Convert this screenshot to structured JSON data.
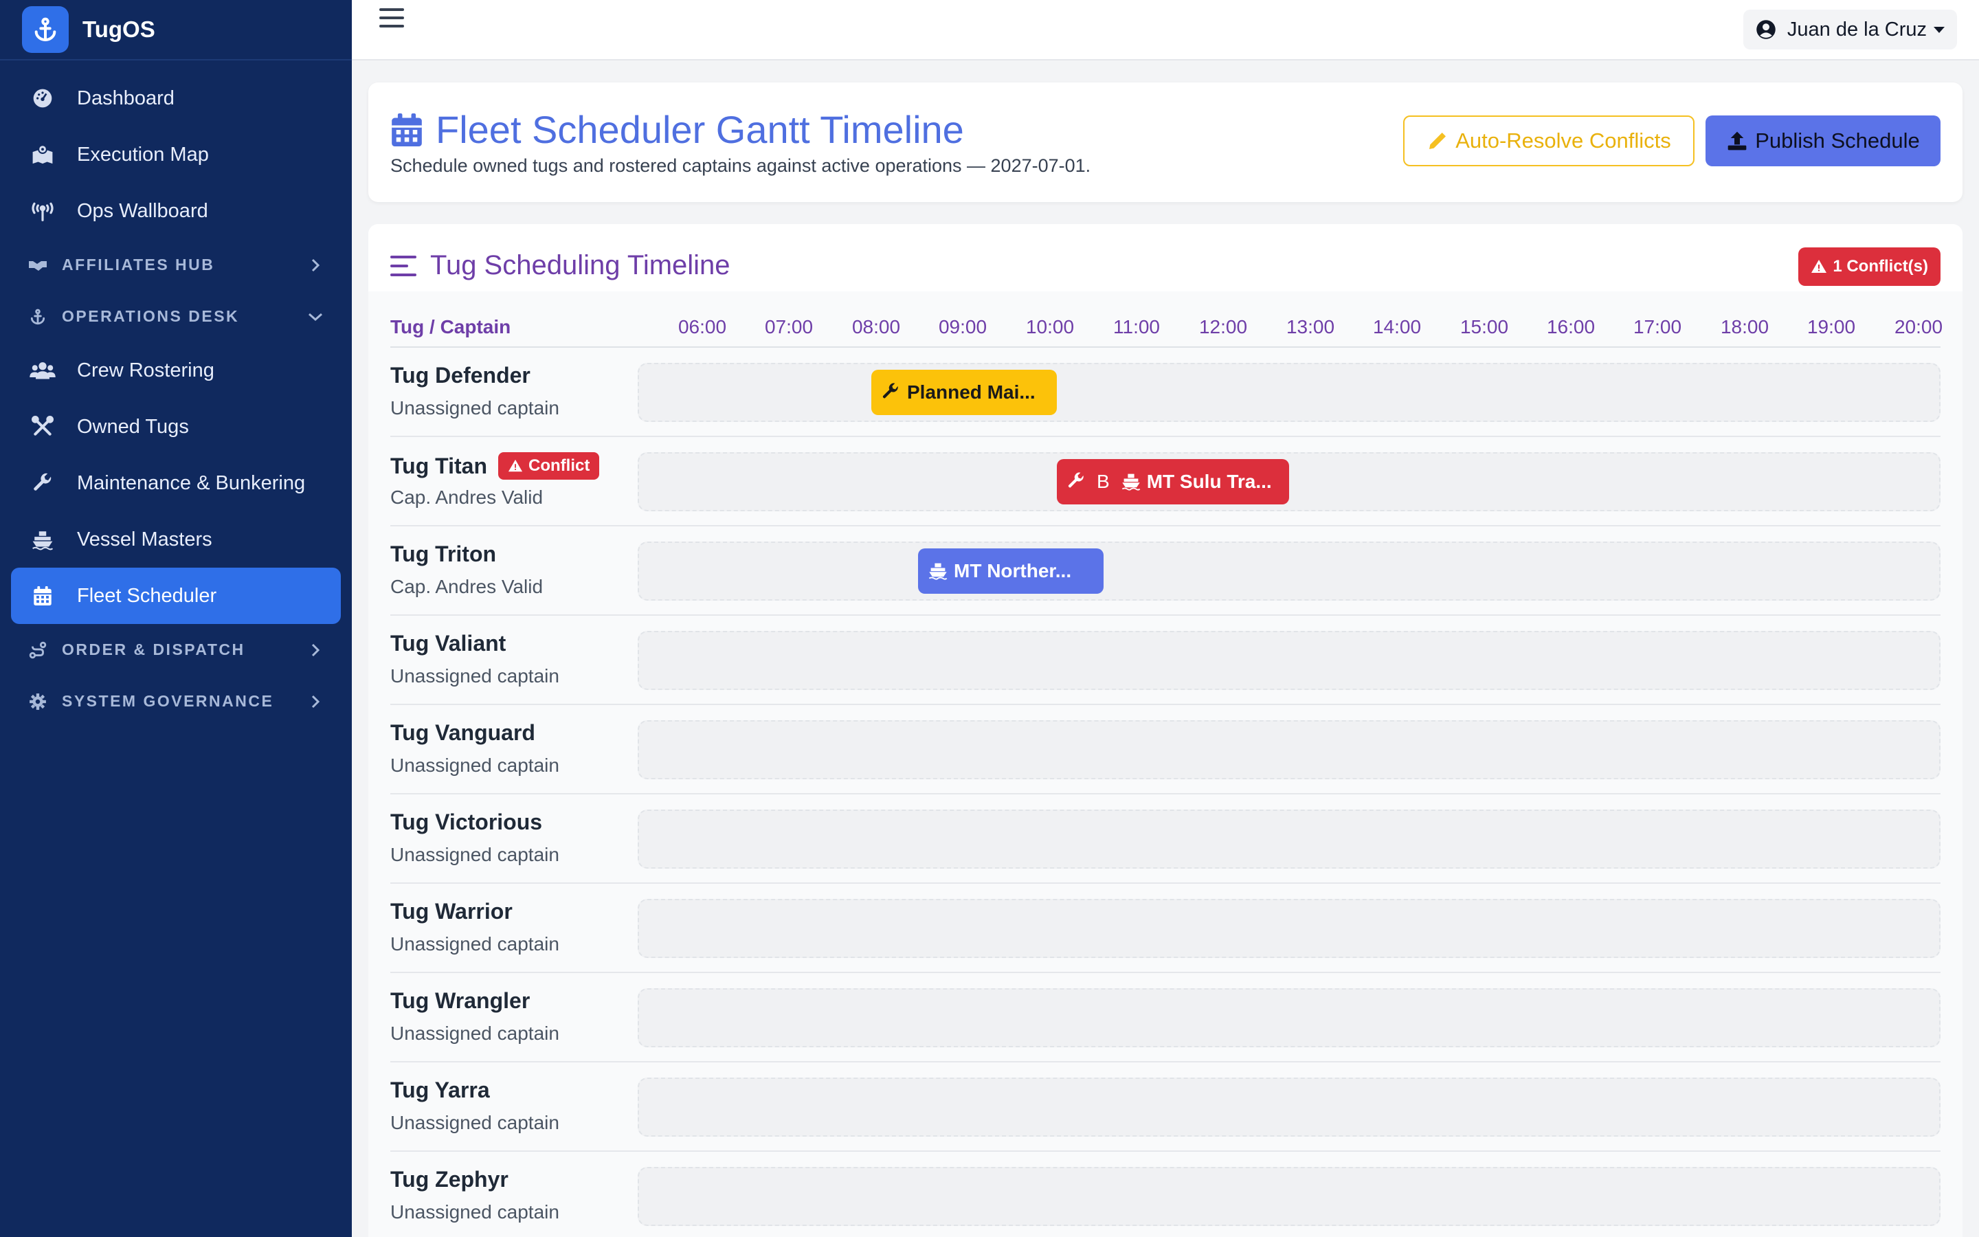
{
  "app": {
    "name": "TugOS"
  },
  "sidebar": {
    "items": [
      {
        "label": "Dashboard",
        "icon": "gauge-icon"
      },
      {
        "label": "Execution Map",
        "icon": "map-marked-icon"
      },
      {
        "label": "Ops Wallboard",
        "icon": "broadcast-tower-icon"
      }
    ],
    "sections": {
      "affiliates": {
        "label": "AFFILIATES HUB",
        "icon": "handshake-icon"
      },
      "operations": {
        "label": "OPERATIONS DESK",
        "icon": "anchor-icon"
      },
      "order": {
        "label": "ORDER & DISPATCH",
        "icon": "route-icon"
      },
      "governance": {
        "label": "SYSTEM GOVERNANCE",
        "icon": "gear-icon"
      }
    },
    "ops_items": [
      {
        "label": "Crew Rostering",
        "icon": "users-icon"
      },
      {
        "label": "Owned Tugs",
        "icon": "tools-icon"
      },
      {
        "label": "Maintenance & Bunkering",
        "icon": "wrench-icon"
      },
      {
        "label": "Vessel Masters",
        "icon": "ship-icon"
      },
      {
        "label": "Fleet Scheduler",
        "icon": "calendar-icon",
        "active": true
      }
    ]
  },
  "topbar": {
    "user_name": "Juan de la Cruz"
  },
  "header": {
    "title": "Fleet Scheduler Gantt Timeline",
    "subtitle": "Schedule owned tugs and rostered captains against active operations — 2027-07-01.",
    "auto_resolve_label": "Auto-Resolve Conflicts",
    "publish_label": "Publish Schedule",
    "accent_color": "#4f6fe0",
    "warning_color": "#f5c022"
  },
  "timeline": {
    "title": "Tug Scheduling Timeline",
    "conflict_count_label": "1 Conflict(s)",
    "column_label": "Tug / Captain",
    "hours": [
      "06:00",
      "07:00",
      "08:00",
      "09:00",
      "10:00",
      "11:00",
      "12:00",
      "13:00",
      "14:00",
      "15:00",
      "16:00",
      "17:00",
      "18:00",
      "19:00",
      "20:00"
    ],
    "rows": [
      {
        "tug": "Tug Defender",
        "captain": "Unassigned captain"
      },
      {
        "tug": "Tug Titan",
        "captain": "Cap. Andres Valid",
        "badge": "Conflict"
      },
      {
        "tug": "Tug Triton",
        "captain": "Cap. Andres Valid"
      },
      {
        "tug": "Tug Valiant",
        "captain": "Unassigned captain"
      },
      {
        "tug": "Tug Vanguard",
        "captain": "Unassigned captain"
      },
      {
        "tug": "Tug Victorious",
        "captain": "Unassigned captain"
      },
      {
        "tug": "Tug Warrior",
        "captain": "Unassigned captain"
      },
      {
        "tug": "Tug Wrangler",
        "captain": "Unassigned captain"
      },
      {
        "tug": "Tug Yarra",
        "captain": "Unassigned captain"
      },
      {
        "tug": "Tug Zephyr",
        "captain": "Unassigned captain"
      }
    ],
    "bars": {
      "defender_maint": {
        "label": "Planned Mai...",
        "start": "08:10",
        "end": "10:20",
        "type": "maintenance",
        "color": "#fcc20a"
      },
      "titan_maint": {
        "label": "B",
        "start": "10:20",
        "end": "11:00",
        "type": "maintenance-conflict",
        "color": "#dc2f3c"
      },
      "titan_ops": {
        "label": "MT Sulu Tra...",
        "start": "11:00",
        "end": "13:00",
        "type": "operation-conflict",
        "color": "#dc2f3c"
      },
      "triton_ops": {
        "label": "MT Norther...",
        "start": "08:40",
        "end": "10:50",
        "type": "operation",
        "color": "#5b73e8"
      }
    }
  }
}
